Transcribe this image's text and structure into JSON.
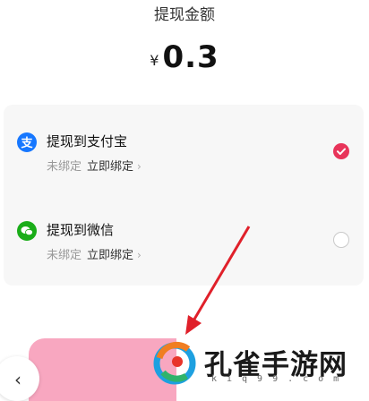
{
  "header": {
    "title": "提现金额",
    "currency_symbol": "¥",
    "amount": "0.3"
  },
  "payment_options": [
    {
      "label": "提现到支付宝",
      "status": "未绑定",
      "bind_label": "立即绑定",
      "chevron": "›",
      "icon": "alipay-icon",
      "icon_color": "#1677ff",
      "selected": true
    },
    {
      "label": "提现到微信",
      "status": "未绑定",
      "bind_label": "立即绑定",
      "chevron": "›",
      "icon": "wechat-icon",
      "icon_color": "#1aad19",
      "selected": false
    }
  ],
  "colors": {
    "selected_radio": "#e8345a",
    "primary_button": "#f8a7c0",
    "annotation_arrow": "#e0202a"
  },
  "footer": {
    "back_icon": "back-arrow-icon",
    "back_glyph": "‹"
  },
  "watermark": {
    "text": "孔雀手游网",
    "subtext": "kiq99.com"
  }
}
